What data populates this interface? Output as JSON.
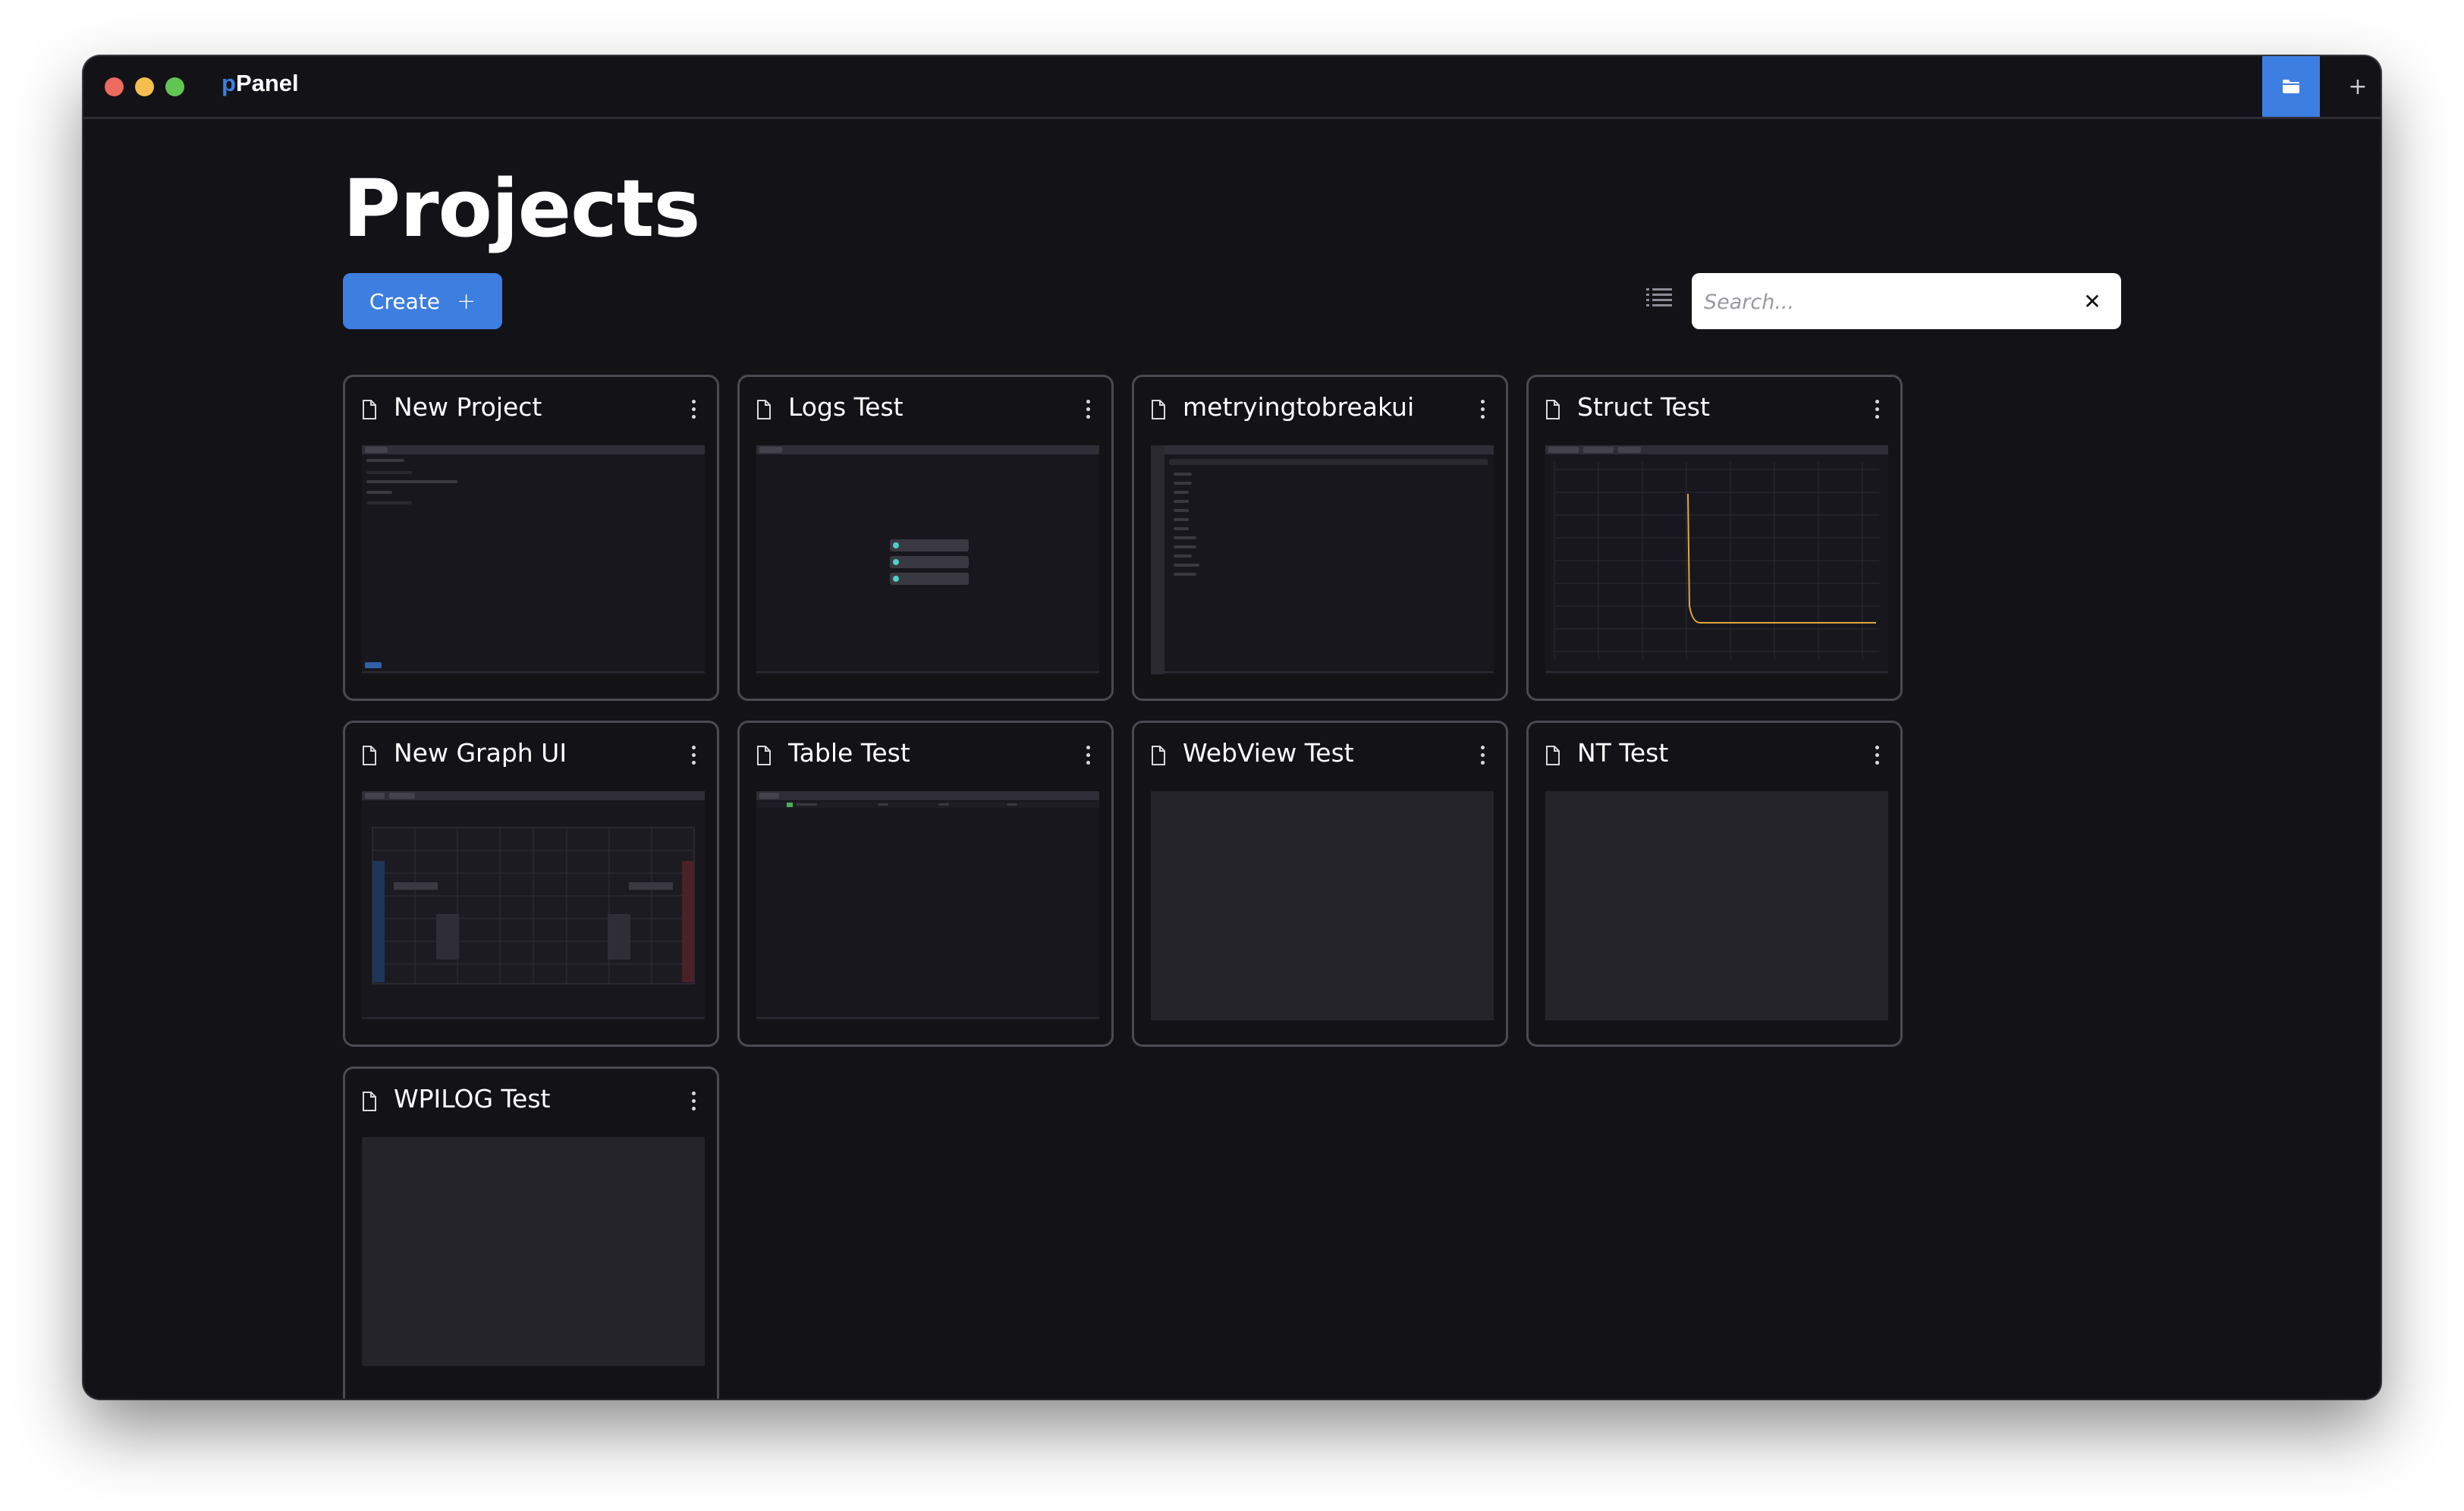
{
  "app": {
    "title_prefix": "p",
    "title_rest": "Panel"
  },
  "titlebar": {
    "active_tab_icon": "folder-icon",
    "add_tab_label": "+"
  },
  "page": {
    "title": "Projects"
  },
  "toolbar": {
    "create_label": "Create",
    "create_icon": "+",
    "view_toggle_icon": "list-icon"
  },
  "search": {
    "placeholder": "Search...",
    "value": "",
    "clear_label": "✕"
  },
  "projects": [
    {
      "name": "New Project"
    },
    {
      "name": "Logs Test"
    },
    {
      "name": "metryingtobreakui"
    },
    {
      "name": "Struct Test"
    },
    {
      "name": "New Graph UI"
    },
    {
      "name": "Table Test"
    },
    {
      "name": "WebView Test"
    },
    {
      "name": "NT Test"
    },
    {
      "name": "WPILOG Test"
    }
  ],
  "colors": {
    "accent": "#3d7ee1",
    "window_bg": "#131217",
    "card_border": "#4b4a52"
  }
}
